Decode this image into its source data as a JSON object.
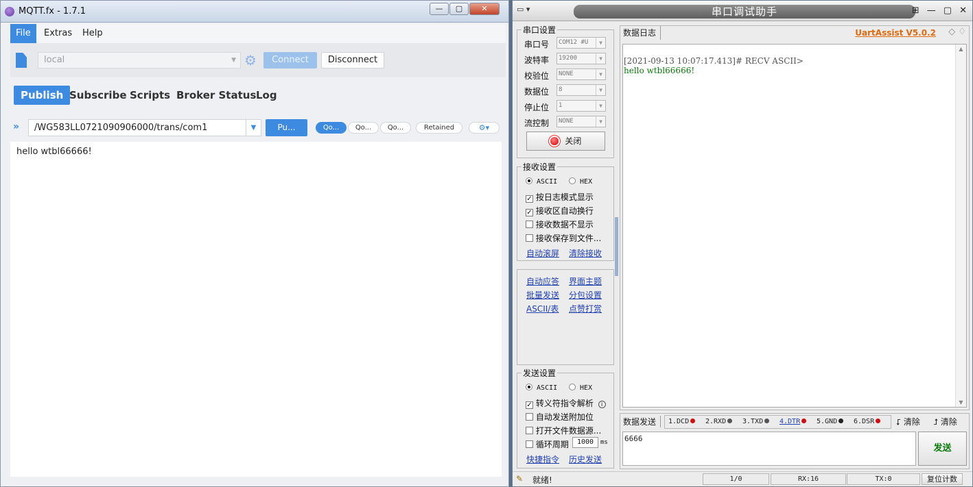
{
  "mqtt": {
    "title": "MQTT.fx - 1.7.1",
    "window_controls": [
      "—",
      "▢",
      "✕"
    ],
    "menu": [
      "File",
      "Extras",
      "Help"
    ],
    "profile": "local",
    "connect_label": "Connect",
    "disconnect_label": "Disconnect",
    "tabs": [
      "Publish",
      "Subscribe",
      "Scripts",
      "Broker Status",
      "Log"
    ],
    "topic": "/WG583LL0721090906000/trans/com1",
    "publish_label": "Pu...",
    "qos": [
      "Qo...",
      "Qo...",
      "Qo..."
    ],
    "retained_label": "Retained",
    "message": "hello wtbl66666!",
    "accent": "#3d8be0"
  },
  "uart": {
    "title": "串口调试助手",
    "serial_settings": {
      "legend": "串口设置",
      "rows": [
        {
          "label": "串口号",
          "value": "COM12 #U"
        },
        {
          "label": "波特率",
          "value": "19200"
        },
        {
          "label": "校验位",
          "value": "NONE"
        },
        {
          "label": "数据位",
          "value": "8"
        },
        {
          "label": "停止位",
          "value": "1"
        },
        {
          "label": "流控制",
          "value": "NONE"
        }
      ],
      "close_label": "关闭"
    },
    "recv_settings": {
      "legend": "接收设置",
      "ascii": "ASCII",
      "hex": "HEX",
      "options": [
        "按日志模式显示",
        "接收区自动换行",
        "接收数据不显示",
        "接收保存到文件..."
      ],
      "links": [
        "自动滚屏",
        "清除接收"
      ]
    },
    "tools": [
      "自动应答",
      "界面主题",
      "批量发送",
      "分包设置",
      "ASCII/表",
      "点赞打赏"
    ],
    "send_settings": {
      "legend": "发送设置",
      "ascii": "ASCII",
      "hex": "HEX",
      "options": [
        "转义符指令解析",
        "自动发送附加位",
        "打开文件数据源...",
        "循环周期"
      ],
      "cycle_value": "1000",
      "cycle_unit": "ms",
      "links": [
        "快捷指令",
        "历史发送"
      ]
    },
    "log": {
      "tab": "数据日志",
      "brand": "UartAssist V5.0.2",
      "header": "[2021-09-13 10:07:17.413]# RECV ASCII>",
      "line": "hello wtbl66666!"
    },
    "send": {
      "tab": "数据发送",
      "signals": [
        {
          "label": "1.DCD",
          "color": "#d01010"
        },
        {
          "label": "2.RXD",
          "color": "#555555"
        },
        {
          "label": "3.TXD",
          "color": "#555555"
        },
        {
          "label": "4.DTR",
          "color": "#d01010"
        },
        {
          "label": "5.GND",
          "color": "#222222"
        },
        {
          "label": "6.DSR",
          "color": "#d01010"
        }
      ],
      "clear1": "清除",
      "clear2": "清除",
      "text": "6666",
      "send_label": "发送"
    },
    "status": {
      "ready": "就绪!",
      "count": "1/0",
      "rx": "RX:16",
      "tx": "TX:0",
      "reset": "复位计数"
    }
  }
}
